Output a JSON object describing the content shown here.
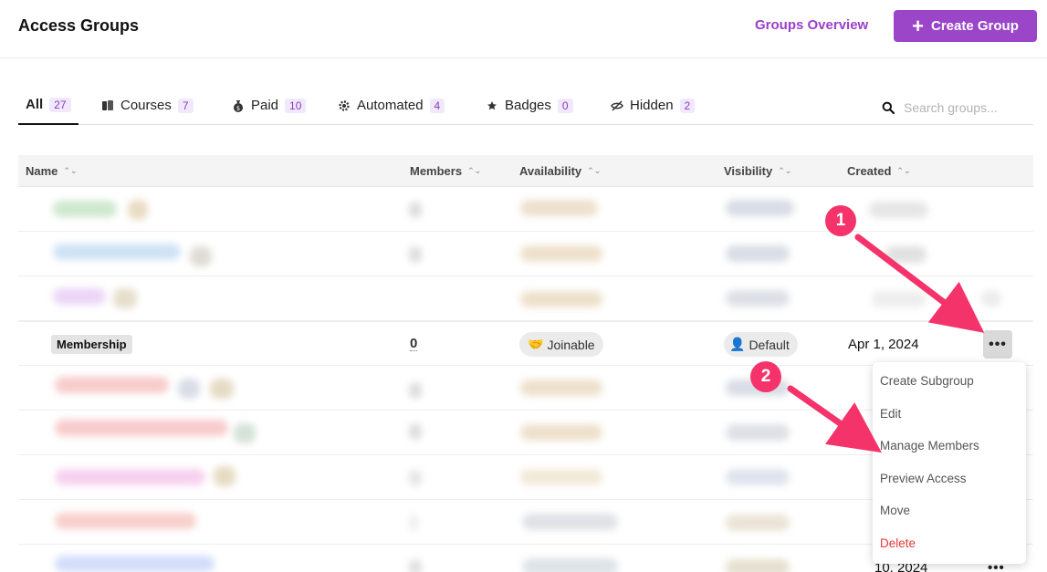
{
  "header": {
    "title": "Access Groups",
    "overview_link": "Groups Overview",
    "create_button": "Create Group"
  },
  "tabs": [
    {
      "label": "All",
      "count": "27",
      "icon": "none",
      "active": true
    },
    {
      "label": "Courses",
      "count": "7",
      "icon": "book-icon"
    },
    {
      "label": "Paid",
      "count": "10",
      "icon": "money-bag-icon"
    },
    {
      "label": "Automated",
      "count": "4",
      "icon": "gear-icon"
    },
    {
      "label": "Badges",
      "count": "0",
      "icon": "star-icon"
    },
    {
      "label": "Hidden",
      "count": "2",
      "icon": "eye-slash-icon"
    }
  ],
  "search": {
    "placeholder": "Search groups..."
  },
  "columns": {
    "name": "Name",
    "members": "Members",
    "availability": "Availability",
    "visibility": "Visibility",
    "created": "Created"
  },
  "focused_row": {
    "name": "Membership",
    "members": "0",
    "availability_icon": "🤝",
    "availability": "Joinable",
    "visibility_icon": "👤",
    "visibility": "Default",
    "created": "Apr 1, 2024",
    "more": "•••"
  },
  "menu": {
    "items": [
      "Create Subgroup",
      "Edit",
      "Manage Members",
      "Preview Access",
      "Move",
      "Delete"
    ]
  },
  "callouts": [
    "1",
    "2"
  ],
  "partial_row": {
    "created_fragment": "10, 2024",
    "more": "•••"
  },
  "colors": {
    "accent": "#9b45c9",
    "callout": "#f5336b",
    "danger": "#e23a3a"
  }
}
